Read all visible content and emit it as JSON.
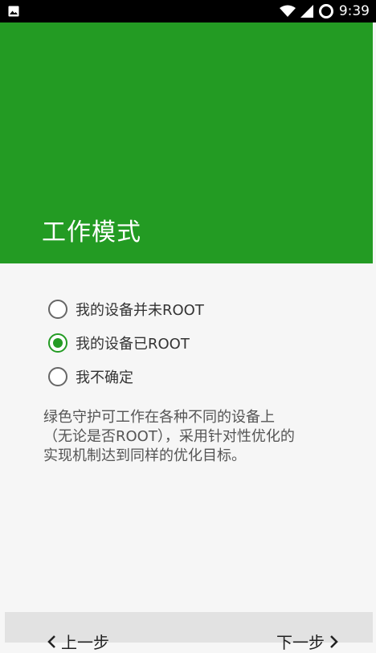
{
  "status_bar": {
    "time": "9:39",
    "icons": [
      "image-icon",
      "wifi-icon",
      "signal-icon",
      "sync-icon"
    ]
  },
  "header": {
    "title": "工作模式"
  },
  "options": [
    {
      "label": "我的设备并未ROOT",
      "checked": false
    },
    {
      "label": "我的设备已ROOT",
      "checked": true
    },
    {
      "label": "我不确定",
      "checked": false
    }
  ],
  "description": {
    "lines": [
      "绿色守护可工作在各种不同的设备上",
      "（无论是否ROOT），采用针对性优化的",
      "实现机制达到同样的优化目标。"
    ]
  },
  "footer": {
    "prev_label": "上一步",
    "next_label": "下一步"
  },
  "colors": {
    "accent": "#239b23",
    "status_bar": "#000000",
    "footer_bg": "#e2e2e2"
  }
}
